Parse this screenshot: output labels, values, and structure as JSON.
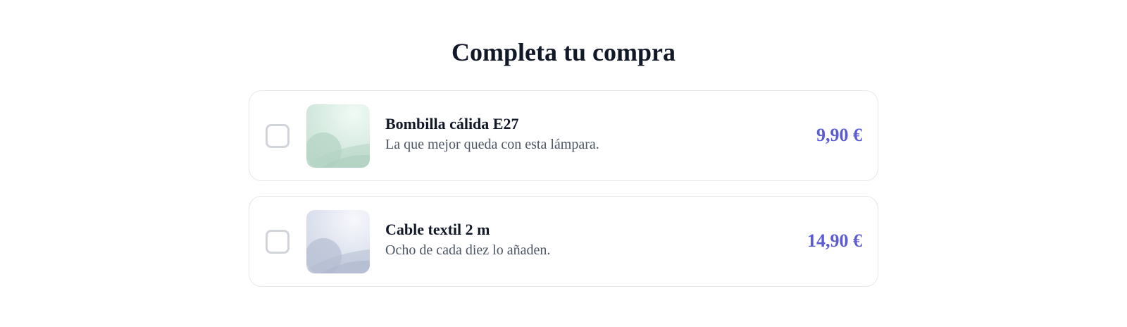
{
  "page": {
    "title": "Completa tu compra"
  },
  "products": [
    {
      "name": "Bombilla cálida E27",
      "description": "La que mejor queda con esta lámpara.",
      "price": "9,90 €",
      "checked": false,
      "thumb_colors": {
        "light": "#f0faf5",
        "mid": "#d2e9df",
        "dark": "#b4d3c4"
      }
    },
    {
      "name": "Cable textil 2 m",
      "description": "Ocho de cada diez lo añaden.",
      "price": "14,90 €",
      "checked": false,
      "thumb_colors": {
        "light": "#f7f8fc",
        "mid": "#dde2ee",
        "dark": "#b5bed2"
      }
    }
  ],
  "colors": {
    "accent": "#5b5bd6",
    "text": "#111827",
    "muted": "#4b5563",
    "border": "#e5e7eb"
  },
  "icons": {
    "checkbox": "checkbox-unchecked-icon",
    "thumbnail": "product-image-placeholder"
  }
}
